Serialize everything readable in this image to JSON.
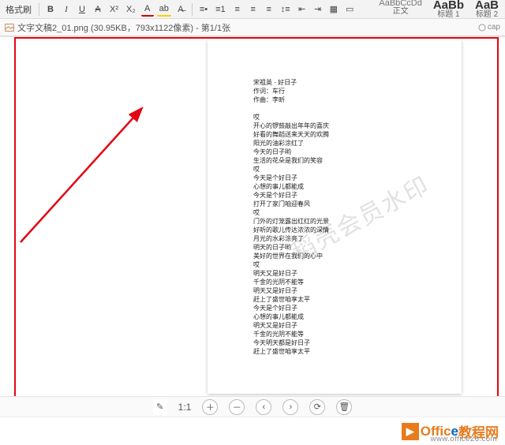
{
  "toolbar": {
    "format_painter": "格式刷",
    "styles": {
      "preview_small": "AaBbCcDd",
      "preview_big1": "AaBb",
      "preview_big2": "AaB",
      "name_body": "正文",
      "name_h1": "标题 1",
      "name_h2": "标题 2"
    }
  },
  "tab": {
    "filename": "文字文稿2_01.png",
    "filesize": "(30.95KB，793x1122像素)",
    "page_info": "- 第1/1张",
    "right_label": "cap"
  },
  "watermark": "稻壳会员水印",
  "document_lines": [
    "宋祖英 - 好日子",
    "作词：车行",
    "作曲：李昕",
    "",
    "哎",
    "开心的锣鼓敲出年年的喜庆",
    "好看的舞蹈送来天天的欢腾",
    "阳光的油彩涂红了",
    "今天的日子哟",
    "生活的花朵是我们的笑容",
    "哎",
    "今天是个好日子",
    "心想的事儿都能成",
    "今天是个好日子",
    "打开了家门咱迎春风",
    "哎",
    "门外的灯笼露出红红的光景",
    "好听的歌儿传达浓浓的深情",
    "月光的水彩涂亮了",
    "明天的日子哟",
    "美好的世界在我们的心中",
    "哎",
    "明天又是好日子",
    "千金的光阴不能等",
    "明天又是好日子",
    "赶上了盛世咱享太平",
    "今天是个好日子",
    "心想的事儿都能成",
    "明天又是好日子",
    "千金的光阴不能等",
    "今天明天都是好日子",
    "赶上了盛世咱享太平"
  ],
  "bottom": {
    "edit": "✎",
    "one_to_one": "1:1",
    "plus": "＋",
    "minus": "－",
    "prev": "‹",
    "next": "›",
    "rotate": "⟳",
    "delete": "🗑"
  },
  "footer": {
    "logo_text": "Offic",
    "logo_e": "e",
    "brand_suffix": "教程网",
    "url": "www.office26.com"
  }
}
